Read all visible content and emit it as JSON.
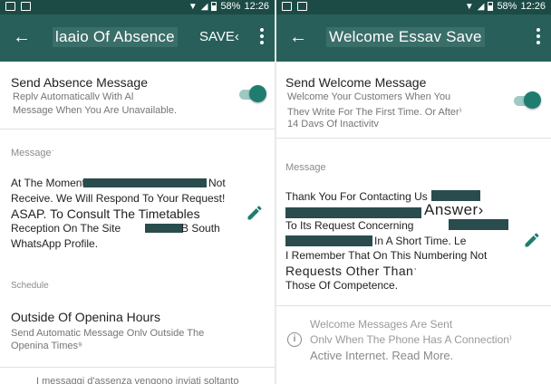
{
  "status": {
    "battery": "58%",
    "time": "12:26"
  },
  "left": {
    "title": "laaio Of Absence",
    "save_label": "SAVE‹",
    "send": {
      "title": "Send Absence Message",
      "line1": "Replv Automaticallv With Al",
      "line2": "Message When You Are Unavailable."
    },
    "message_label": "Messageˑ",
    "message": {
      "line1a": "At The Moment",
      "line1b": "Not",
      "line2": "Receive. We Will Respond To Your Request!",
      "line3": "ASAP. To Consult The Timetables",
      "line4a": "Reception On The Site",
      "line4b": "B South",
      "line5": "WhatsApp Profile."
    },
    "schedule_label": "Schedule",
    "schedule": {
      "title": "Outside Of Openina Hours",
      "line1": "Send Automatic Message Onlv Outside The",
      "line2": "Openina Times⁹"
    },
    "footer": "I messaggi d'assenza vengono inviati soltanto"
  },
  "right": {
    "title": "Welcome Essav Save",
    "send": {
      "title": "Send Welcome Message",
      "line1": "Welcome Your Customers When You",
      "line2": "Thev Write For The First Time. Or After⁾",
      "line3": "14 Davs Of Inactivitv"
    },
    "message_label": "Message",
    "message": {
      "line1": "Thank You For Contacting Us",
      "line2": "Answer›",
      "line3": "To Its Request Concerning",
      "line4": "In A Short Time. Le",
      "line5": "I Remember That On This Numbering Not",
      "line6": "Requests Other Thanˑ",
      "line7": "Those Of Competence."
    },
    "info": {
      "line1": "Welcome Messages Are Sent",
      "line2": "Onlv When The Phone Has A Connection⁾",
      "line3": "Active Internet. Read More."
    }
  },
  "colors": {
    "statusbar": "#1c4b46",
    "toolbar": "#285f5a",
    "accent": "#1e7d6f",
    "redaction": "#2a4c4d"
  },
  "icons": {
    "back": "arrow-left-icon",
    "more": "more-vert-icon",
    "edit": "pencil-icon",
    "info": "info-circle-icon"
  }
}
